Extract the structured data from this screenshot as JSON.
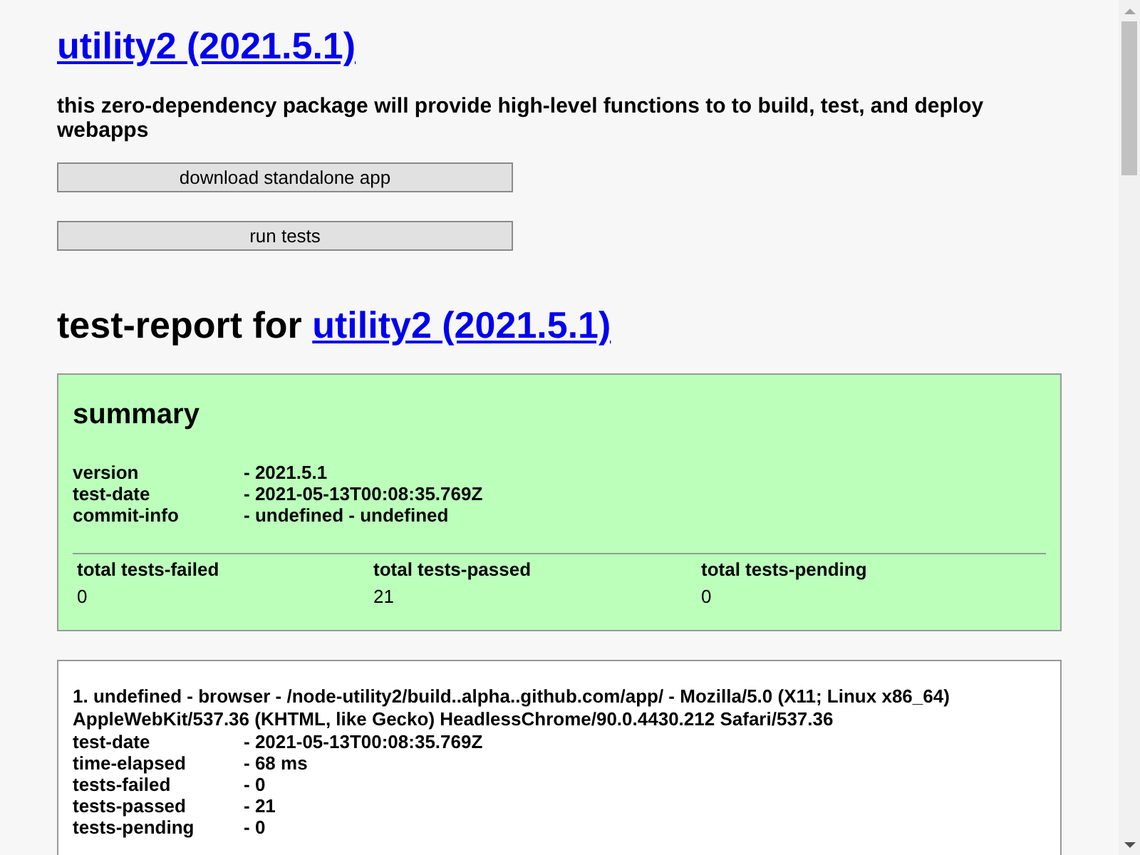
{
  "header": {
    "title": "utility2 (2021.5.1)",
    "description": "this zero-dependency package will provide high-level functions to to build, test, and deploy webapps",
    "buttons": [
      "download standalone app",
      "run tests"
    ]
  },
  "report": {
    "heading_prefix": "test-report for",
    "heading_link": "utility2 (2021.5.1)",
    "summary": {
      "heading": "summary",
      "passed": true,
      "fields": [
        {
          "label": "version",
          "value": "- 2021.5.1"
        },
        {
          "label": "test-date",
          "value": "- 2021-05-13T00:08:35.769Z"
        },
        {
          "label": "commit-info",
          "value": "- undefined - undefined"
        }
      ],
      "totals": [
        {
          "label": "total tests-failed",
          "value": "0"
        },
        {
          "label": "total tests-passed",
          "value": "21"
        },
        {
          "label": "total tests-pending",
          "value": "0"
        }
      ]
    },
    "platforms": [
      {
        "title": "1. undefined - browser - /node-utility2/build..alpha..github.com/app/ - Mozilla/5.0 (X11; Linux x86_64) AppleWebKit/537.36 (KHTML, like Gecko) HeadlessChrome/90.0.4430.212 Safari/537.36",
        "fields": [
          {
            "label": "test-date",
            "value": "- 2021-05-13T00:08:35.769Z"
          },
          {
            "label": "time-elapsed",
            "value": "- 68 ms"
          },
          {
            "label": "tests-failed",
            "value": "- 0"
          },
          {
            "label": "tests-passed",
            "value": "- 21"
          },
          {
            "label": "tests-pending",
            "value": "- 0"
          }
        ]
      }
    ]
  }
}
